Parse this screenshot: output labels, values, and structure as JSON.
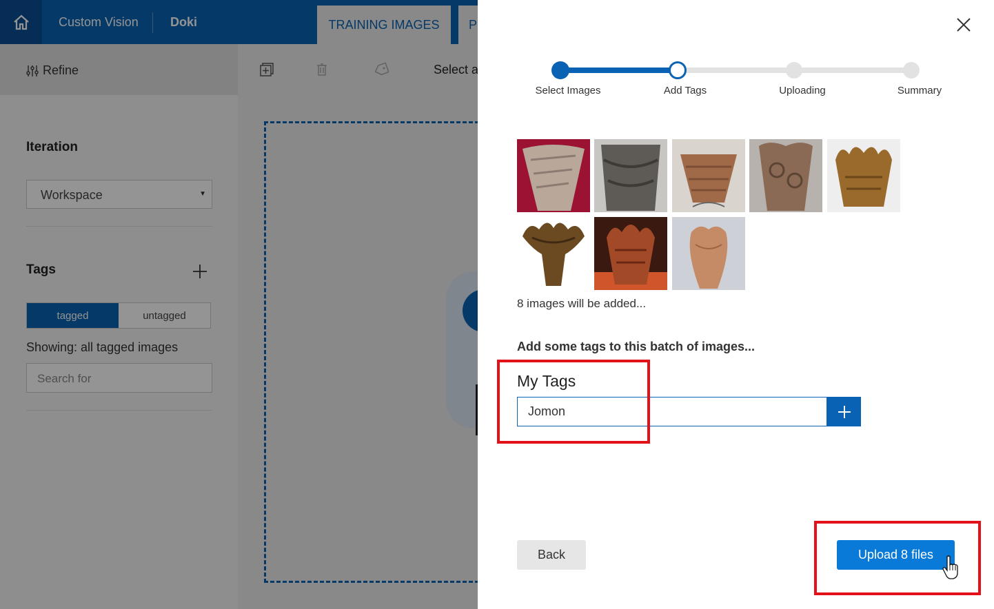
{
  "header": {
    "brand": "Custom Vision",
    "project": "Doki",
    "tabs": [
      {
        "label": "TRAINING IMAGES"
      },
      {
        "label": "PE"
      }
    ]
  },
  "toolbar": {
    "refine_label": "Refine",
    "select_all_label": "Select al"
  },
  "sidebar": {
    "iteration_heading": "Iteration",
    "iteration_value": "Workspace",
    "tags_heading": "Tags",
    "toggle": {
      "tagged": "tagged",
      "untagged": "untagged",
      "selected": "tagged"
    },
    "showing_text": "Showing: all tagged images",
    "search_placeholder": "Search for"
  },
  "dialog": {
    "steps": [
      {
        "label": "Select Images",
        "state": "complete"
      },
      {
        "label": "Add Tags",
        "state": "current"
      },
      {
        "label": "Uploading",
        "state": "pending"
      },
      {
        "label": "Summary",
        "state": "pending"
      }
    ],
    "images_note": "8 images will be added...",
    "tags_prompt": "Add some tags to this batch of images...",
    "my_tags_label": "My Tags",
    "tag_input_value": "Jomon",
    "back_label": "Back",
    "upload_label": "Upload 8 files"
  },
  "colors": {
    "accent": "#0a62b4",
    "upload_button": "#0a7ad8",
    "highlight": "#e2111a"
  },
  "icons": [
    "home-icon",
    "refine-sliders-icon",
    "add-images-icon",
    "delete-icon",
    "tag-icon",
    "plus-icon",
    "close-icon",
    "pointer-hand-icon"
  ]
}
